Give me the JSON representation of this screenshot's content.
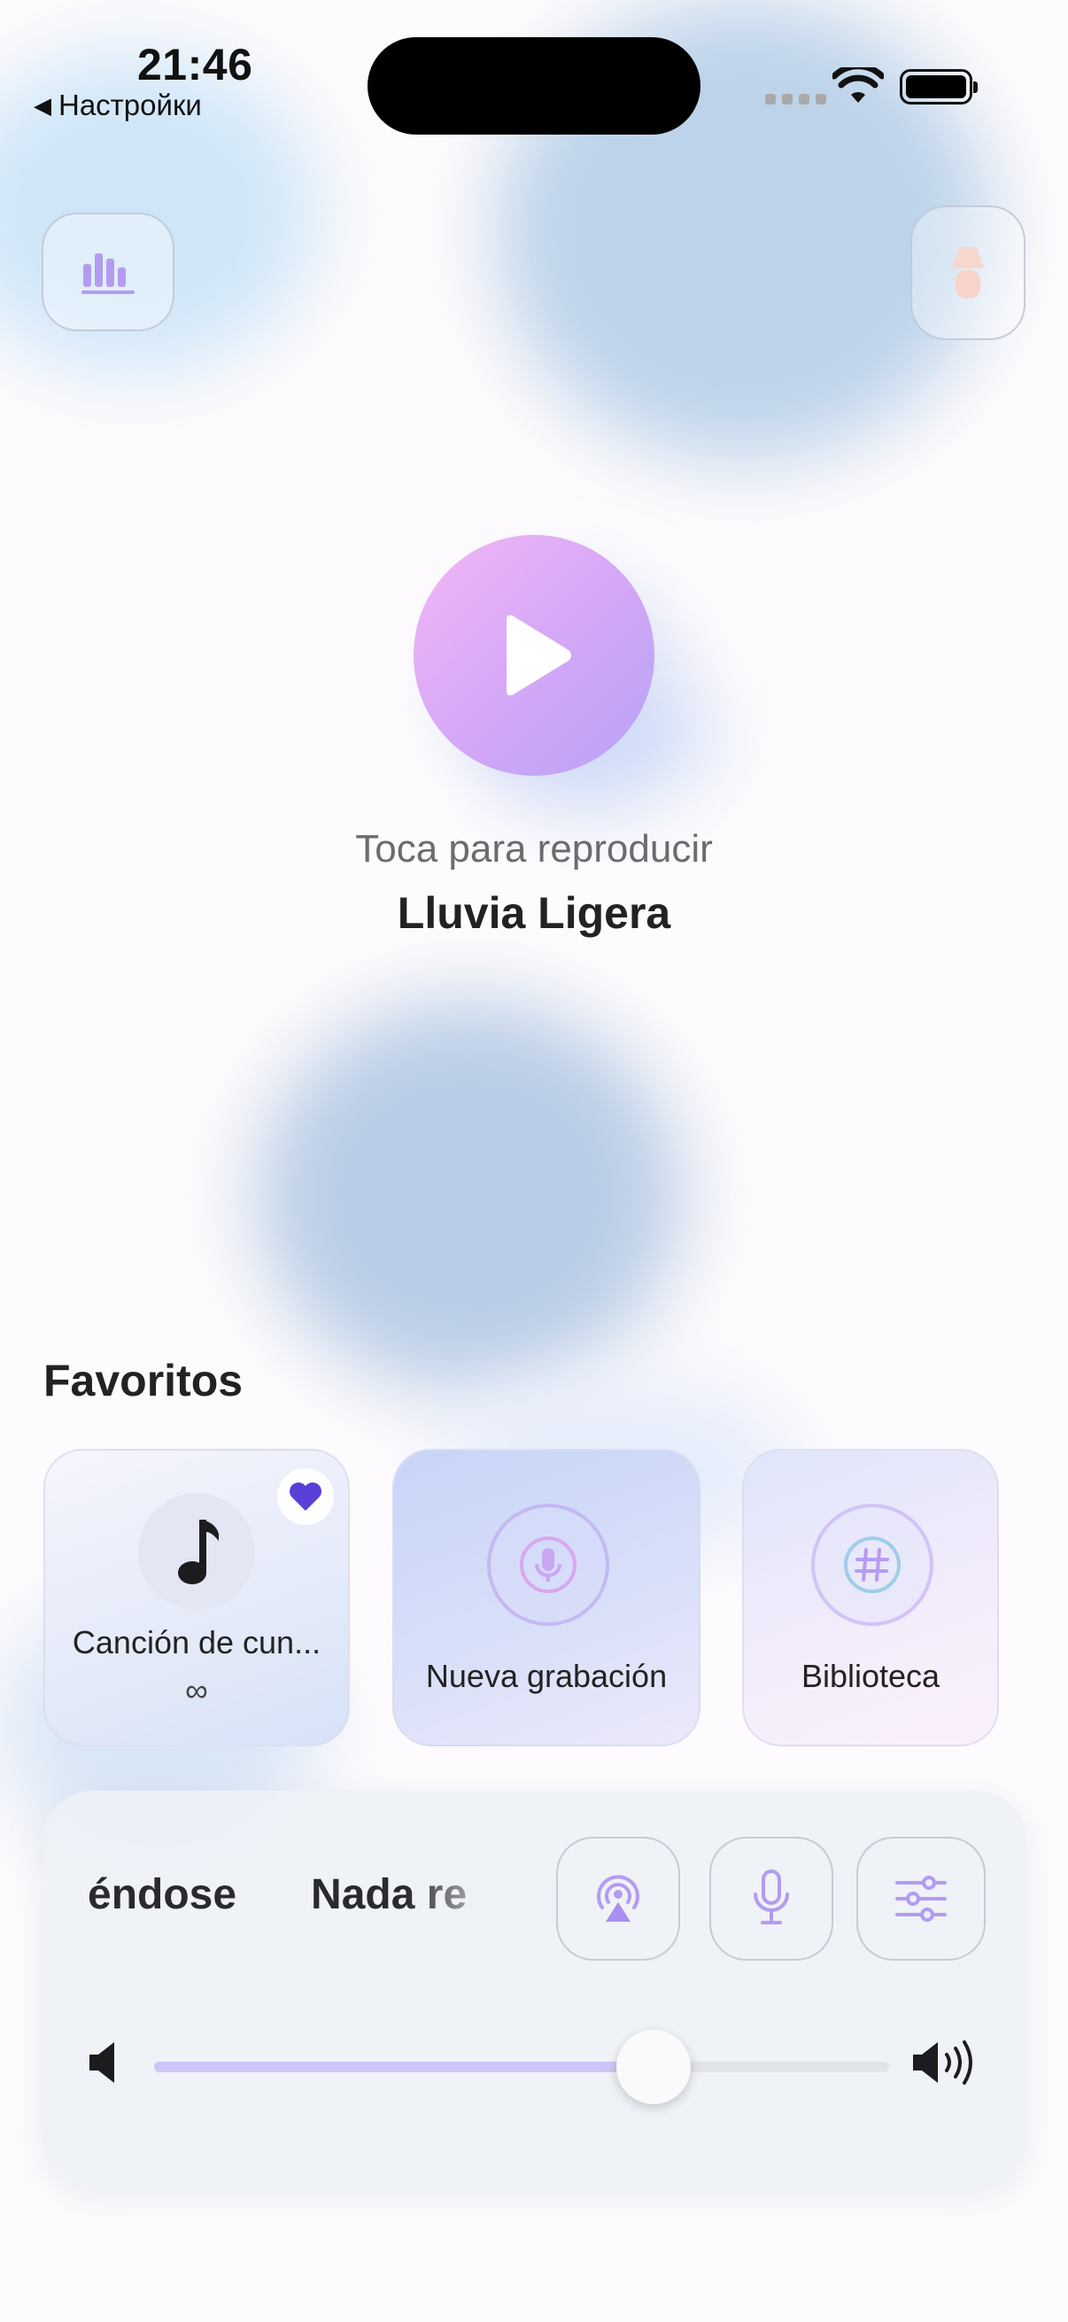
{
  "status_bar": {
    "time": "21:46",
    "back_label": "Настройки",
    "back_glyph": "◀"
  },
  "header": {
    "left_button_icon": "equalizer-icon",
    "right_button_icon": "lamp-icon"
  },
  "player": {
    "hint": "Toca para reproducir",
    "track_name": "Lluvia Ligera",
    "play_icon": "play-icon"
  },
  "favorites": {
    "title": "Favoritos",
    "cards": [
      {
        "label": "Canción de cun...",
        "sub": "∞",
        "icon": "music-note-icon",
        "favorited": true
      },
      {
        "label": "Nueva grabación",
        "icon": "microphone-icon"
      },
      {
        "label": "Biblioteca",
        "icon": "hashtag-icon"
      }
    ]
  },
  "panel": {
    "marquee": [
      "éndose",
      "Nada re"
    ],
    "controls": [
      "airplay-icon",
      "microphone-icon",
      "sliders-icon"
    ],
    "volume": 0.68
  },
  "colors": {
    "accent": "#b7a2f7",
    "play_gradient_start": "#f5b6f5",
    "play_gradient_end": "#b7a2f7",
    "heart": "#5a3fd6",
    "slider_fill": "#cfc5f6"
  }
}
